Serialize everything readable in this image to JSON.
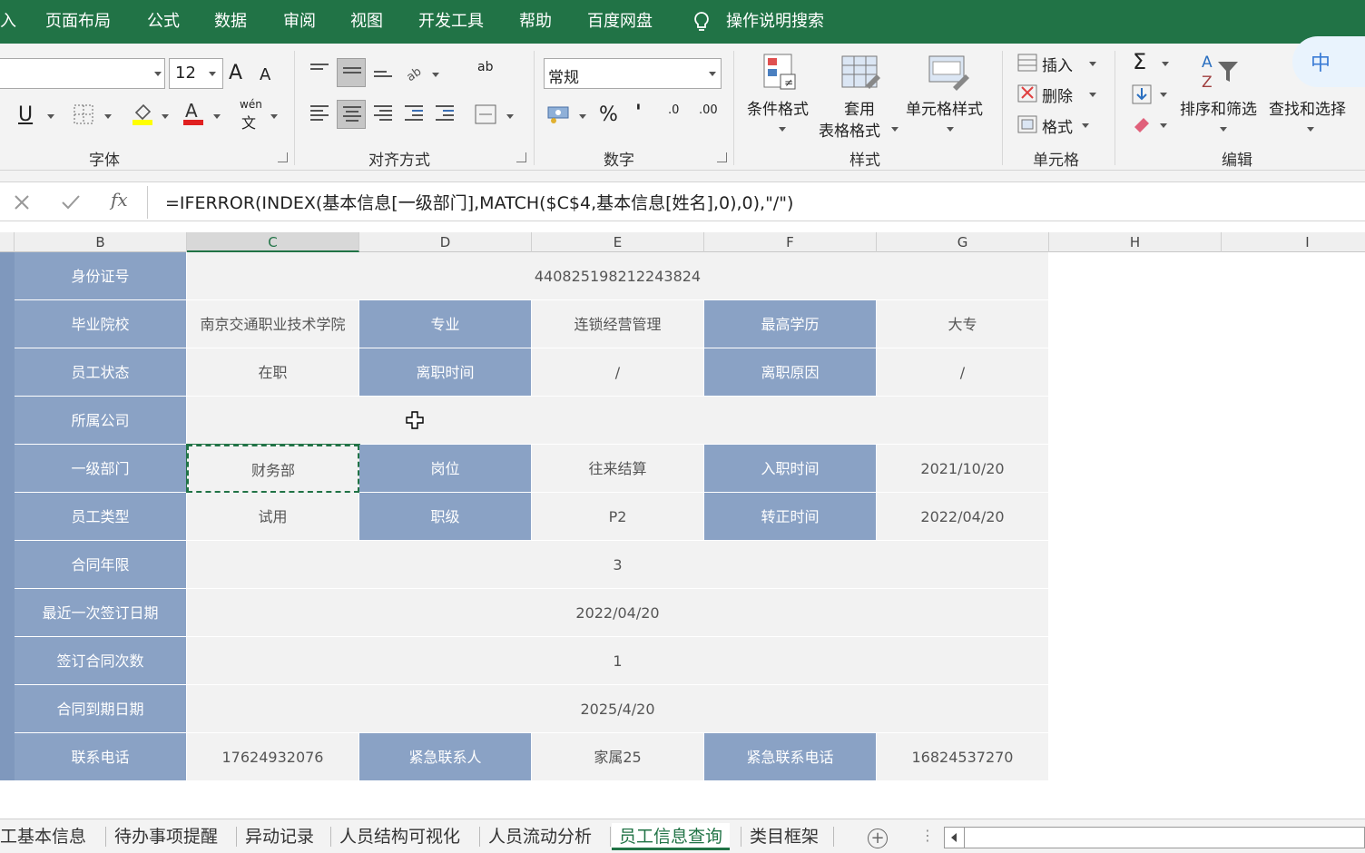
{
  "menu": {
    "items": [
      "入",
      "页面布局",
      "公式",
      "数据",
      "审阅",
      "视图",
      "开发工具",
      "帮助",
      "百度网盘",
      "操作说明搜索"
    ]
  },
  "ribbon": {
    "font_size": "12",
    "number_format": "常规",
    "groups": {
      "font": "字体",
      "alignment": "对齐方式",
      "number": "数字",
      "styles": "样式",
      "cells": "单元格",
      "editing": "编辑"
    },
    "buttons": {
      "conditional_format": "条件格式",
      "table_format_line1": "套用",
      "table_format_line2": "表格格式",
      "cell_style": "单元格样式",
      "insert": "插入",
      "delete": "删除",
      "format": "格式",
      "sort_filter": "排序和筛选",
      "find_select": "查找和选择",
      "percent": "%",
      "comma": "'",
      "inc_decimal": ".0",
      "dec_decimal": ".00",
      "wen_top": "wén",
      "wen_bottom": "文",
      "underline": "U",
      "font_grow": "A",
      "font_shrink": "A",
      "wrap": "ab",
      "sum": "Σ"
    },
    "ime": "中"
  },
  "formula_bar": {
    "fx": "fx",
    "formula": "=IFERROR(INDEX(基本信息[一级部门],MATCH($C$4,基本信息[姓名],0),0),\"/\")"
  },
  "columns": [
    "B",
    "C",
    "D",
    "E",
    "F",
    "G",
    "H",
    "I"
  ],
  "active_column": "C",
  "rows": [
    {
      "label": "身份证号",
      "merged": "440825198212243824"
    },
    {
      "label": "毕业院校",
      "c": "南京交通职业技术学院",
      "d": "专业",
      "e": "连锁经营管理",
      "f": "最高学历",
      "g": "大专"
    },
    {
      "label": "员工状态",
      "c": "在职",
      "d": "离职时间",
      "e": "/",
      "f": "离职原因",
      "g": "/"
    },
    {
      "label": "所属公司",
      "merged": ""
    },
    {
      "label": "一级部门",
      "c": "财务部",
      "d": "岗位",
      "e": "往来结算",
      "f": "入职时间",
      "g": "2021/10/20"
    },
    {
      "label": "员工类型",
      "c": "试用",
      "d": "职级",
      "e": "P2",
      "f": "转正时间",
      "g": "2022/04/20"
    },
    {
      "label": "合同年限",
      "merged": "3"
    },
    {
      "label": "最近一次签订日期",
      "merged": "2022/04/20"
    },
    {
      "label": "签订合同次数",
      "merged": "1"
    },
    {
      "label": "合同到期日期",
      "merged": "2025/4/20"
    },
    {
      "label": "联系电话",
      "c": "17624932076",
      "d": "紧急联系人",
      "e": "家属25",
      "f": "紧急联系电话",
      "g": "16824537270"
    }
  ],
  "sheet_tabs": [
    "工基本信息",
    "待办事项提醒",
    "异动记录",
    "人员结构可视化",
    "人员流动分析",
    "员工信息查询",
    "类目框架"
  ],
  "active_tab": "员工信息查询",
  "add_sheet": "+",
  "tab_more": "⋮"
}
